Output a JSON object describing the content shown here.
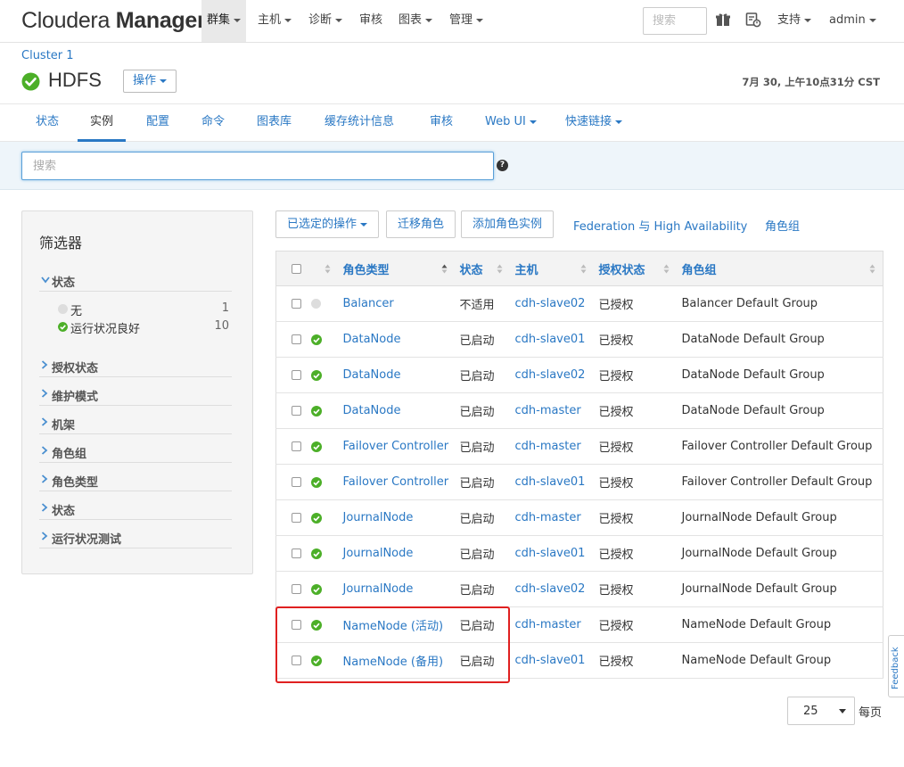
{
  "topnav": {
    "logo_light": "Cloudera",
    "logo_bold": "Manager",
    "items": [
      {
        "label": "群集",
        "dropdown": true,
        "active": true
      },
      {
        "label": "主机",
        "dropdown": true
      },
      {
        "label": "诊断",
        "dropdown": true
      },
      {
        "label": "审核",
        "dropdown": false
      },
      {
        "label": "图表",
        "dropdown": true
      },
      {
        "label": "管理",
        "dropdown": true
      }
    ],
    "search_placeholder": "搜索",
    "support_label": "支持",
    "user_label": "admin",
    "icons": [
      "gift-icon",
      "running-commands-icon"
    ]
  },
  "service": {
    "cluster_name": "Cluster 1",
    "name": "HDFS",
    "actions_label": "操作",
    "status": "good-health",
    "timestamp": "7月 30, 上午10点31分 CST"
  },
  "tabs": [
    {
      "label": "状态"
    },
    {
      "label": "实例",
      "active": true
    },
    {
      "label": "配置"
    },
    {
      "label": "命令"
    },
    {
      "label": "图表库"
    },
    {
      "label": "缓存统计信息"
    },
    {
      "label": "审核"
    },
    {
      "label": "Web UI",
      "dropdown": true
    },
    {
      "label": "快速链接",
      "dropdown": true
    }
  ],
  "search": {
    "placeholder": "搜索",
    "help": "?"
  },
  "filters": {
    "title": "筛选器",
    "status_group": {
      "label": "状态",
      "expanded": true,
      "options": [
        {
          "label": "无",
          "count": "1",
          "color": "#dddddd"
        },
        {
          "label": "运行状况良好",
          "count": "10",
          "color": "#4caf28"
        }
      ]
    },
    "groups": [
      "授权状态",
      "维护模式",
      "机架",
      "角色组",
      "角色类型",
      "状态",
      "运行状况测试"
    ]
  },
  "toolbar": {
    "selected_actions": "已选定的操作",
    "migrate_roles": "迁移角色",
    "add_role_instances": "添加角色实例",
    "federation_ha": "Federation 与 High Availability",
    "role_groups": "角色组"
  },
  "table": {
    "headers": {
      "role_type": "角色类型",
      "status": "状态",
      "host": "主机",
      "commission": "授权状态",
      "role_group": "角色组"
    },
    "rows": [
      {
        "health": "none",
        "role_type": "Balancer",
        "status": "不适用",
        "host": "cdh-slave02",
        "commission": "已授权",
        "role_group": "Balancer Default Group"
      },
      {
        "health": "good",
        "role_type": "DataNode",
        "status": "已启动",
        "host": "cdh-slave01",
        "commission": "已授权",
        "role_group": "DataNode Default Group"
      },
      {
        "health": "good",
        "role_type": "DataNode",
        "status": "已启动",
        "host": "cdh-slave02",
        "commission": "已授权",
        "role_group": "DataNode Default Group"
      },
      {
        "health": "good",
        "role_type": "DataNode",
        "status": "已启动",
        "host": "cdh-master",
        "commission": "已授权",
        "role_group": "DataNode Default Group"
      },
      {
        "health": "good",
        "role_type": "Failover Controller",
        "status": "已启动",
        "host": "cdh-master",
        "commission": "已授权",
        "role_group": "Failover Controller Default Group"
      },
      {
        "health": "good",
        "role_type": "Failover Controller",
        "status": "已启动",
        "host": "cdh-slave01",
        "commission": "已授权",
        "role_group": "Failover Controller Default Group"
      },
      {
        "health": "good",
        "role_type": "JournalNode",
        "status": "已启动",
        "host": "cdh-master",
        "commission": "已授权",
        "role_group": "JournalNode Default Group"
      },
      {
        "health": "good",
        "role_type": "JournalNode",
        "status": "已启动",
        "host": "cdh-slave01",
        "commission": "已授权",
        "role_group": "JournalNode Default Group"
      },
      {
        "health": "good",
        "role_type": "JournalNode",
        "status": "已启动",
        "host": "cdh-slave02",
        "commission": "已授权",
        "role_group": "JournalNode Default Group"
      },
      {
        "health": "good",
        "role_type": "NameNode (活动)",
        "status": "已启动",
        "host": "cdh-master",
        "commission": "已授权",
        "role_group": "NameNode Default Group"
      },
      {
        "health": "good",
        "role_type": "NameNode (备用)",
        "status": "已启动",
        "host": "cdh-slave01",
        "commission": "已授权",
        "role_group": "NameNode Default Group"
      }
    ]
  },
  "pagination": {
    "page_size": "25",
    "per_page_label": "每页"
  },
  "feedback_label": "Feedback",
  "colors": {
    "link": "#2a78c4",
    "health_good": "#4caf28",
    "highlight": "#e02020"
  }
}
